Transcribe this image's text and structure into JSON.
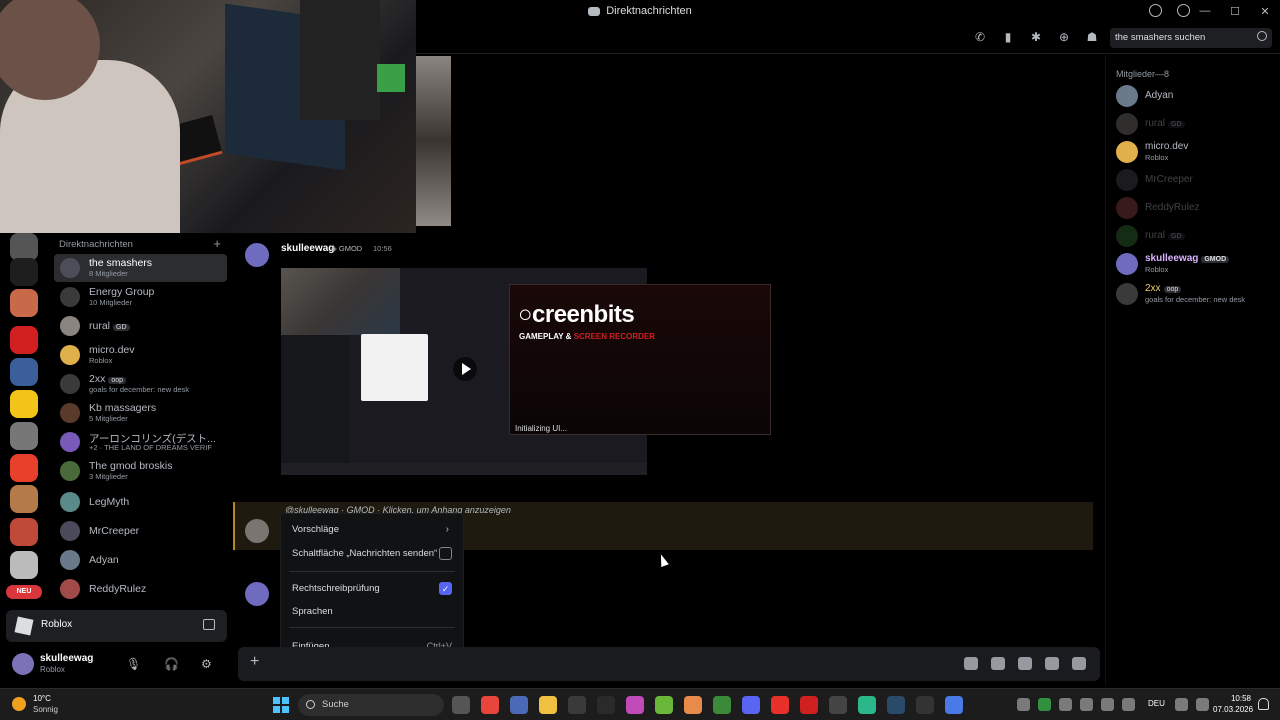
{
  "window": {
    "title": "Direktnachrichten"
  },
  "search": {
    "placeholder": "the smashers suchen"
  },
  "dm_header": "Direktnachrichten",
  "dms": [
    {
      "name": "the smashers",
      "sub": "8 Mitglieder",
      "selected": true
    },
    {
      "name": "Energy Group",
      "sub": "10 Mitglieder"
    },
    {
      "name": "rural",
      "tag": "GD",
      "sub": ""
    },
    {
      "name": "micro.dev",
      "sub": "Roblox"
    },
    {
      "name": "2xx",
      "tag": "oop",
      "sub": "goals for december: new desk"
    },
    {
      "name": "Kb massagers",
      "sub": "5 Mitglieder"
    },
    {
      "name": "アーロンコリンズ(デスト...",
      "sub": "+2 · THE LAND OF DREAMS VERIF"
    },
    {
      "name": "The gmod broskis",
      "sub": "3 Mitglieder"
    },
    {
      "name": "LegMyth",
      "sub": ""
    },
    {
      "name": "MrCreeper",
      "sub": ""
    },
    {
      "name": "Adyan",
      "sub": ""
    },
    {
      "name": "ReddyRulez",
      "sub": ""
    }
  ],
  "server_badge": "NEU",
  "activity": {
    "label": "Roblox"
  },
  "user": {
    "name": "skulleewag",
    "status": "Roblox"
  },
  "message": {
    "author": "skulleewag",
    "badge": "GMOD",
    "time": "10:56",
    "embed": {
      "logo": "creenbits",
      "sub_white": "GAMEPLAY & ",
      "sub_red": "SCREEN RECORDER",
      "init": "Initializing UI..."
    },
    "reply_line": "@skulleewag · GMOD · Klicken, um Anhang anzuzeigen"
  },
  "context_menu": {
    "items": [
      {
        "label": "Vorschläge",
        "kind": "submenu"
      },
      {
        "label": "Schaltfläche „Nachrichten senden“",
        "kind": "checkbox",
        "checked": false
      },
      {
        "label": "Rechtschreibprüfung",
        "kind": "checkbox",
        "checked": true
      },
      {
        "label": "Sprachen",
        "kind": "plain"
      },
      {
        "label": "Einfügen",
        "kind": "shortcut",
        "shortcut": "Ctrl+V"
      }
    ]
  },
  "members": {
    "header": "Mitglieder—8",
    "list": [
      {
        "name": "Adyan",
        "sub": ""
      },
      {
        "name": "rural",
        "tag": "GD",
        "sub": "",
        "offline": true
      },
      {
        "name": "micro.dev",
        "sub": "Roblox"
      },
      {
        "name": "MrCreeper",
        "sub": "",
        "offline": true
      },
      {
        "name": "ReddyRulez",
        "sub": "",
        "offline": true
      },
      {
        "name": "rural",
        "tag": "GD",
        "sub": "",
        "offline": true
      },
      {
        "name": "skulleewag",
        "tag": "GMOD",
        "sub": "Roblox"
      },
      {
        "name": "2xx",
        "tag": "oop",
        "sub": "goals for december: new desk"
      }
    ]
  },
  "taskbar": {
    "weather_temp": "10°C",
    "weather_cond": "Sonnig",
    "search": "Suche",
    "lang": "DEU",
    "time": "10:58",
    "date": "07.03.2026"
  }
}
